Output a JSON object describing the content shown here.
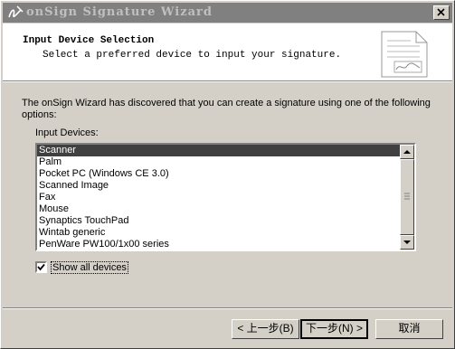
{
  "window": {
    "title": "onSign Signature Wizard",
    "icon": "signature-pen-icon",
    "close_icon": "close-icon"
  },
  "header": {
    "title": "Input Device Selection",
    "subtitle": "Select a preferred device to input your signature."
  },
  "body": {
    "intro": "The onSign Wizard has discovered that you can create a signature using one of the following options:",
    "list_label": "Input Devices:",
    "devices": [
      "Scanner",
      "Palm",
      "Pocket PC (Windows CE 3.0)",
      "Scanned Image",
      "Fax",
      "Mouse",
      "Synaptics TouchPad",
      "Wintab generic",
      "PenWare PW100/1x00 series"
    ],
    "selected_device": "Scanner",
    "show_all_label": "Show all devices",
    "show_all_checked": true
  },
  "buttons": {
    "back": "< 上一步(B)",
    "next": "下一步(N) >",
    "cancel": "取消"
  }
}
